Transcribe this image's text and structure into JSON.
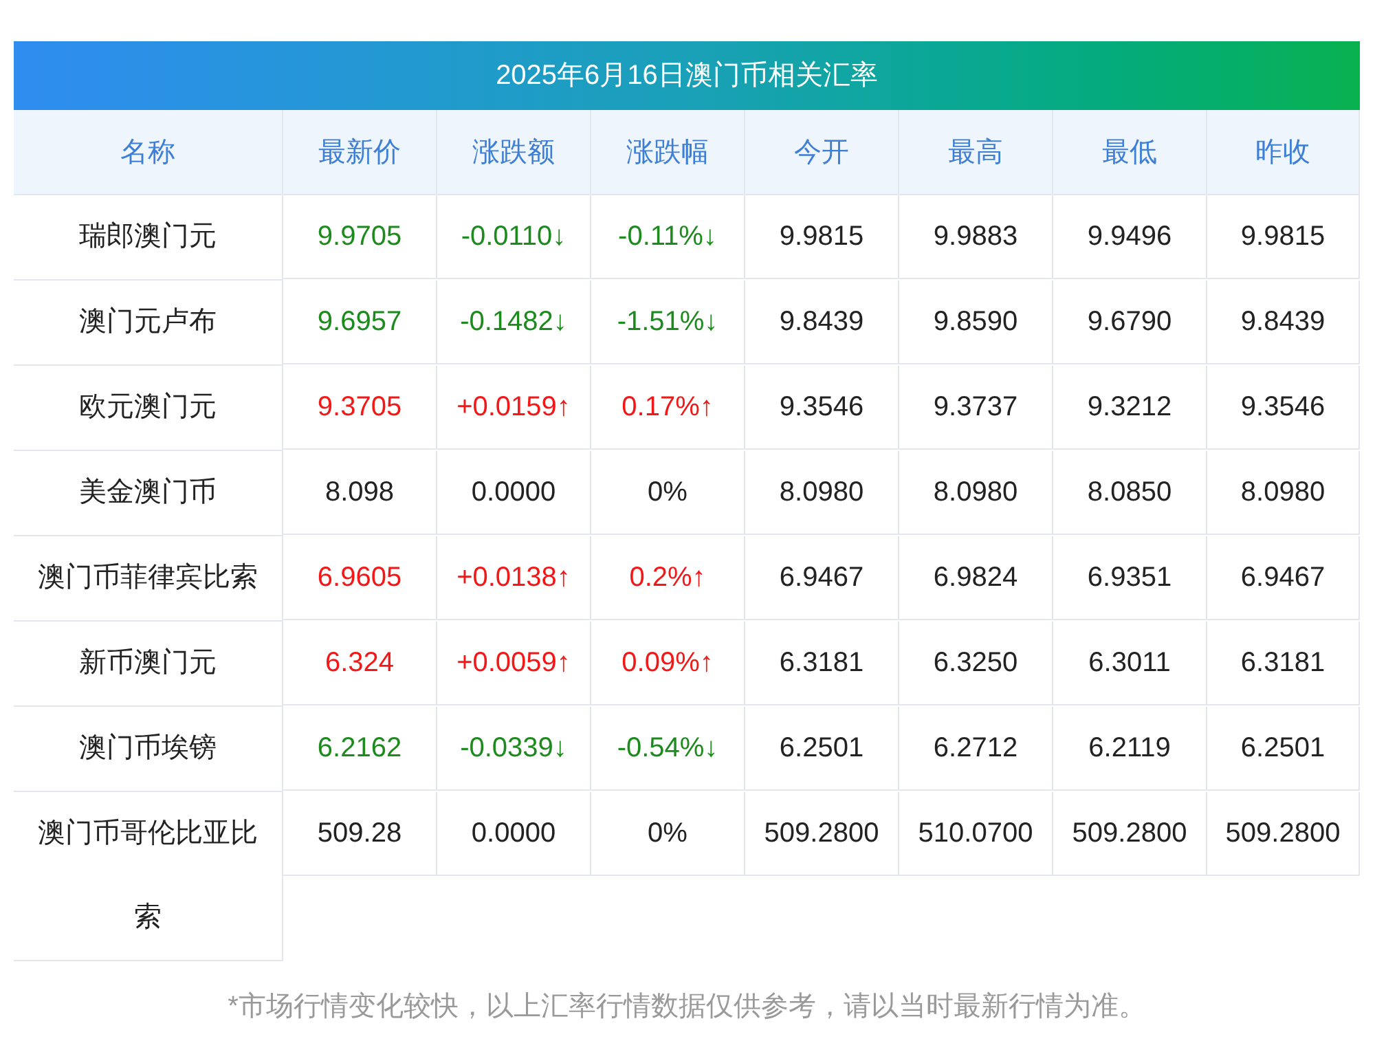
{
  "title": "2025年6月16日澳门币相关汇率",
  "columns": [
    "名称",
    "最新价",
    "涨跌额",
    "涨跌幅",
    "今开",
    "最高",
    "最低",
    "昨收"
  ],
  "rows": [
    {
      "name": "瑞郎澳门元",
      "color": "#1c8a1c",
      "latest": "9.9705",
      "change": "-0.0110↓",
      "pct": "-0.11%↓",
      "open": "9.9815",
      "high": "9.9883",
      "low": "9.9496",
      "prev": "9.9815"
    },
    {
      "name": "澳门元卢布",
      "color": "#1c8a1c",
      "latest": "9.6957",
      "change": "-0.1482↓",
      "pct": "-1.51%↓",
      "open": "9.8439",
      "high": "9.8590",
      "low": "9.6790",
      "prev": "9.8439"
    },
    {
      "name": "欧元澳门元",
      "color": "#f21818",
      "latest": "9.3705",
      "change": "+0.0159↑",
      "pct": "0.17%↑",
      "open": "9.3546",
      "high": "9.3737",
      "low": "9.3212",
      "prev": "9.3546"
    },
    {
      "name": "美金澳门币",
      "color": "#222222",
      "latest": "8.098",
      "change": "0.0000",
      "pct": "0%",
      "open": "8.0980",
      "high": "8.0980",
      "low": "8.0850",
      "prev": "8.0980"
    },
    {
      "name": "澳门币菲律宾比索",
      "color": "#f21818",
      "latest": "6.9605",
      "change": "+0.0138↑",
      "pct": "0.2%↑",
      "open": "6.9467",
      "high": "6.9824",
      "low": "6.9351",
      "prev": "6.9467"
    },
    {
      "name": "新币澳门元",
      "color": "#f21818",
      "latest": "6.324",
      "change": "+0.0059↑",
      "pct": "0.09%↑",
      "open": "6.3181",
      "high": "6.3250",
      "low": "6.3011",
      "prev": "6.3181"
    },
    {
      "name": "澳门币埃镑",
      "color": "#1c8a1c",
      "latest": "6.2162",
      "change": "-0.0339↓",
      "pct": "-0.54%↓",
      "open": "6.2501",
      "high": "6.2712",
      "low": "6.2119",
      "prev": "6.2501"
    },
    {
      "name": "澳门币哥伦比亚比索",
      "color": "#222222",
      "latest": "509.28",
      "change": "0.0000",
      "pct": "0%",
      "open": "509.2800",
      "high": "510.0700",
      "low": "509.2800",
      "prev": "509.2800"
    }
  ],
  "footnote": "*市场行情变化较快，以上汇率行情数据仅供参考，请以当时最新行情为准。"
}
